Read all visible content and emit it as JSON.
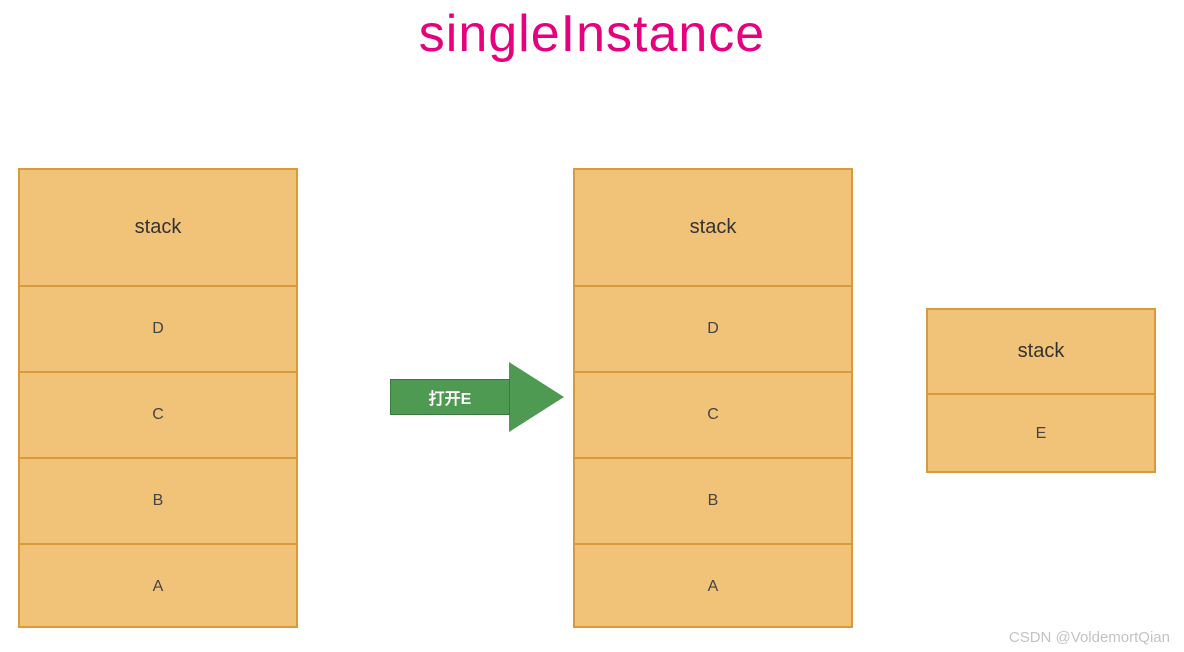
{
  "title": "singleInstance",
  "arrow_label": "打开E",
  "stacks": {
    "left": {
      "header": "stack",
      "cells": [
        "D",
        "C",
        "B",
        "A"
      ]
    },
    "middle": {
      "header": "stack",
      "cells": [
        "D",
        "C",
        "B",
        "A"
      ]
    },
    "right": {
      "header": "stack",
      "cells": [
        "E"
      ]
    }
  },
  "watermark": "CSDN @VoldemortQian",
  "colors": {
    "title": "#e6007e",
    "stack_fill": "#f1c378",
    "stack_border": "#d89a3a",
    "arrow_fill": "#4f9a52",
    "arrow_text": "#ffffff"
  }
}
